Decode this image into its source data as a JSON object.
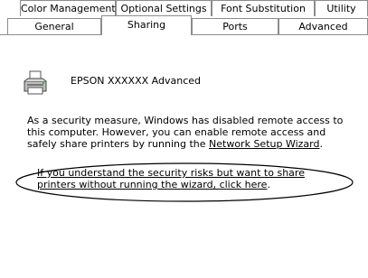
{
  "tabs_back": [
    "Color Management",
    "Optional Settings",
    "Font Substitution",
    "Utility"
  ],
  "tabs_front": [
    "General",
    "Sharing",
    "Ports",
    "Advanced"
  ],
  "active_tab": "Sharing",
  "printer": {
    "name": "EPSON XXXXXX Advanced"
  },
  "security": {
    "text1": "As a security measure, Windows has disabled remote access to this computer. However, you can enable remote access and safely share printers by running the ",
    "wizard_link": "Network Setup Wizard",
    "text1_end": ".",
    "override_link": "If you understand the security risks but want to share printers without running the wizard, click here",
    "override_end": "."
  }
}
